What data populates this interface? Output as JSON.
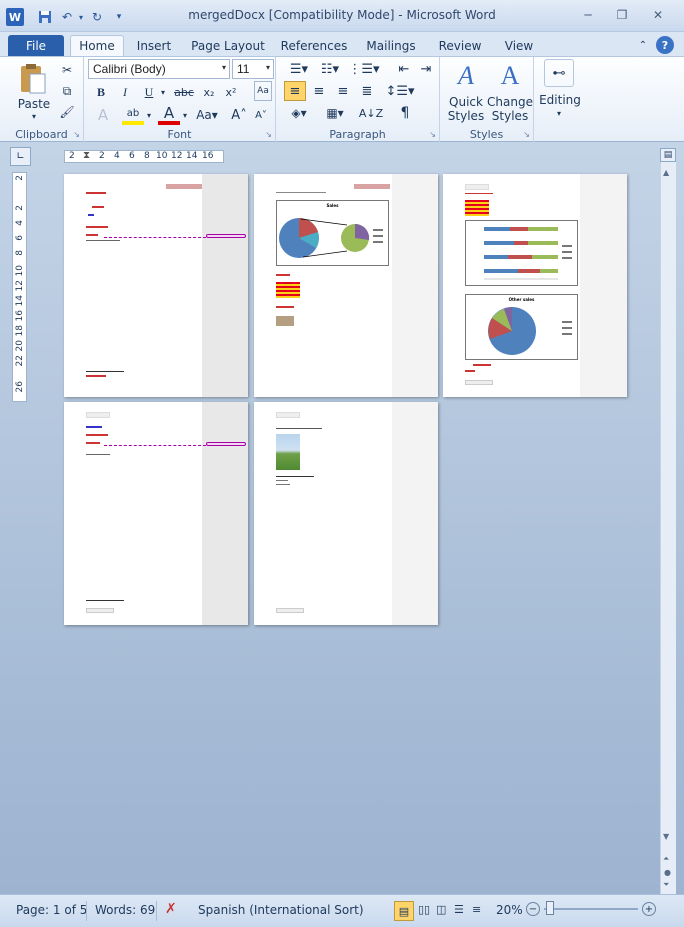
{
  "window": {
    "title": "mergedDocx [Compatibility Mode]  -  Microsoft Word"
  },
  "qat": {
    "app_icon": "W"
  },
  "tabs": [
    "File",
    "Home",
    "Insert",
    "Page Layout",
    "References",
    "Mailings",
    "Review",
    "View"
  ],
  "ribbon": {
    "clipboard": {
      "label": "Clipboard",
      "paste": "Paste"
    },
    "font": {
      "label": "Font",
      "font_name": "Calibri (Body)",
      "font_size": "11"
    },
    "paragraph": {
      "label": "Paragraph"
    },
    "styles": {
      "label": "Styles",
      "quick_styles_1": "Quick",
      "quick_styles_2": "Styles",
      "change_styles_1": "Change",
      "change_styles_2": "Styles"
    },
    "editing": {
      "label": "Editing"
    }
  },
  "ruler": {
    "h_ticks": [
      "2",
      "2",
      "4",
      "6",
      "8",
      "10",
      "12",
      "14",
      "16"
    ],
    "v_ticks": [
      "2",
      "2",
      "4",
      "6",
      "8",
      "10",
      "12",
      "14",
      "16",
      "18",
      "20",
      "22",
      "26"
    ]
  },
  "pages": {
    "p2_chart_title": "Sales",
    "p3_chart_title": "Other sales"
  },
  "status": {
    "page": "Page: 1 of 5",
    "words": "Words: 69",
    "language": "Spanish (International Sort)",
    "zoom": "20%"
  }
}
